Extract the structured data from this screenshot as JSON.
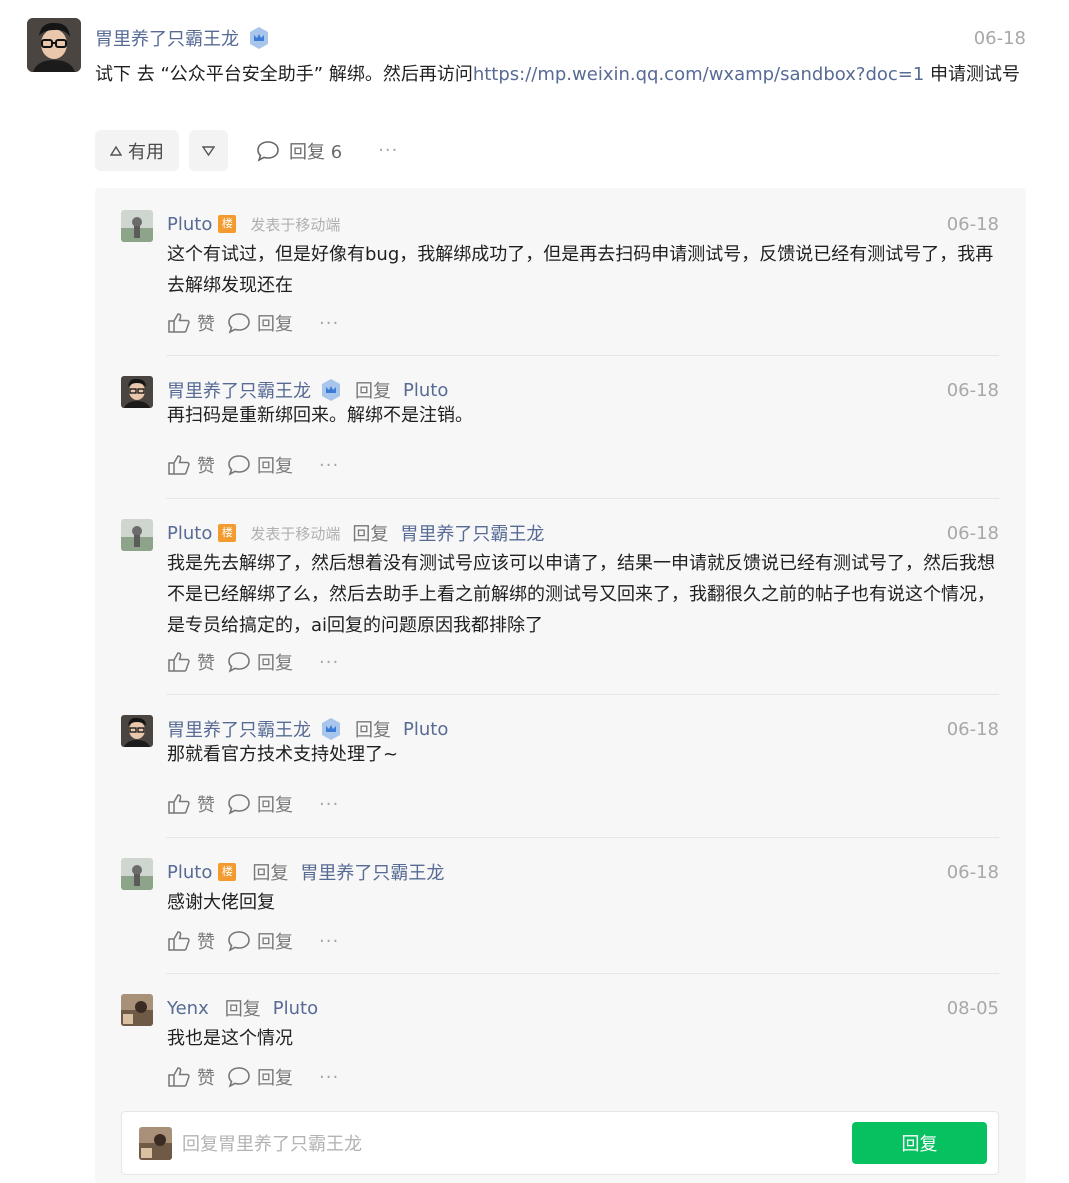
{
  "main": {
    "author": "胃里养了只霸王龙",
    "date": "06-18",
    "content_before": "试下 去 “公众平台安全助手” 解绑。然后再访问",
    "link": "https://mp.weixin.qq.com/wxamp/sandbox?doc=1",
    "content_after": " 申请测试号",
    "useful_label": "有用",
    "reply_label": "回复 6",
    "more": "···"
  },
  "replies": [
    {
      "name": "Pluto",
      "floor": "楼",
      "source": "发表于移动端",
      "reply_word": "",
      "reply_to": "",
      "date": "06-18",
      "text": "这个有试过，但是好像有bug，我解绑成功了，但是再去扫码申请测试号，反馈说已经有测试号了，我再去解绑发现还在",
      "like": "赞",
      "reply": "回复",
      "more": "···"
    },
    {
      "name": "胃里养了只霸王龙",
      "floor": "",
      "source": "",
      "reply_word": "回复",
      "reply_to": "Pluto",
      "date": "06-18",
      "text": "再扫码是重新绑回来。解绑不是注销。",
      "like": "赞",
      "reply": "回复",
      "more": "···"
    },
    {
      "name": "Pluto",
      "floor": "楼",
      "source": "发表于移动端",
      "reply_word": "回复",
      "reply_to": "胃里养了只霸王龙",
      "date": "06-18",
      "text": "我是先去解绑了，然后想着没有测试号应该可以申请了，结果一申请就反馈说已经有测试号了，然后我想不是已经解绑了么，然后去助手上看之前解绑的测试号又回来了，我翻很久之前的帖子也有说这个情况，是专员给搞定的，ai回复的问题原因我都排除了",
      "like": "赞",
      "reply": "回复",
      "more": "···"
    },
    {
      "name": "胃里养了只霸王龙",
      "floor": "",
      "source": "",
      "reply_word": "回复",
      "reply_to": "Pluto",
      "date": "06-18",
      "text": "那就看官方技术支持处理了~",
      "like": "赞",
      "reply": "回复",
      "more": "···"
    },
    {
      "name": "Pluto",
      "floor": "楼",
      "source": "",
      "reply_word": "回复",
      "reply_to": "胃里养了只霸王龙",
      "date": "06-18",
      "text": "感谢大佬回复",
      "like": "赞",
      "reply": "回复",
      "more": "···"
    },
    {
      "name": "Yenx",
      "floor": "",
      "source": "",
      "reply_word": "回复",
      "reply_to": "Pluto",
      "date": "08-05",
      "text": "我也是这个情况",
      "like": "赞",
      "reply": "回复",
      "more": "···"
    }
  ],
  "composer": {
    "placeholder": "回复胃里养了只霸王龙",
    "submit_label": "回复"
  },
  "colors": {
    "link": "#576b95",
    "accent_green": "#07c160",
    "floor_badge": "#f39b2f"
  }
}
